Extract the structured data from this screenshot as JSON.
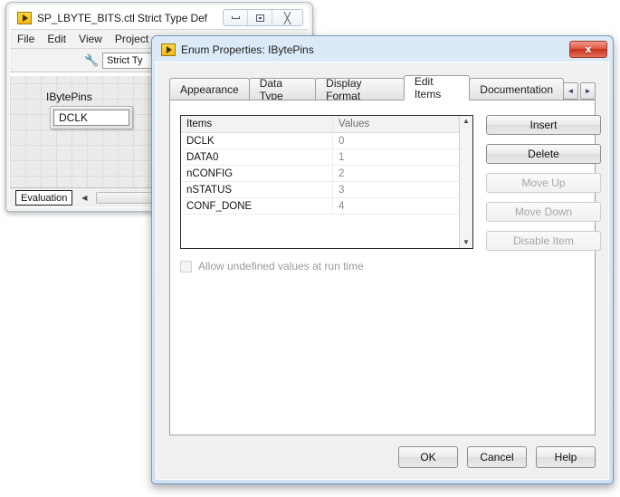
{
  "background_window": {
    "title": "SP_LBYTE_BITS.ctl Strict Type Def",
    "icon": "labview-run-arrow-icon",
    "window_buttons": {
      "minimize": "minimize-icon",
      "restore": "restore-icon",
      "close": "close-icon"
    },
    "menu": [
      {
        "label": "File"
      },
      {
        "label": "Edit"
      },
      {
        "label": "View"
      },
      {
        "label": "Project"
      }
    ],
    "toolbar": {
      "wrench_icon": "wrench-icon",
      "typedef_combo_value": "Strict Ty"
    },
    "canvas": {
      "control_label": "IBytePins",
      "control_value": "DCLK"
    },
    "status_bar": {
      "label": "Evaluation",
      "scroll_left_icon": "scroll-left-arrow-icon"
    }
  },
  "dialog": {
    "title": "Enum Properties: IBytePins",
    "icon": "labview-run-arrow-icon",
    "close_label": "x",
    "tabs": [
      {
        "label": "Appearance",
        "selected": false
      },
      {
        "label": "Data Type",
        "selected": false
      },
      {
        "label": "Display Format",
        "selected": false
      },
      {
        "label": "Edit Items",
        "selected": true
      },
      {
        "label": "Documentation",
        "selected": false
      }
    ],
    "tab_nav": {
      "prev": "◄",
      "next": "►"
    },
    "edit_items": {
      "columns": [
        "Items",
        "Values"
      ],
      "rows": [
        {
          "item": "DCLK",
          "value": "0"
        },
        {
          "item": "DATA0",
          "value": "1"
        },
        {
          "item": "nCONFIG",
          "value": "2"
        },
        {
          "item": "nSTATUS",
          "value": "3"
        },
        {
          "item": "CONF_DONE",
          "value": "4"
        }
      ],
      "scrollbar": {
        "up": "▲",
        "down": "▼"
      },
      "side_buttons": [
        {
          "label": "Insert",
          "disabled": false
        },
        {
          "label": "Delete",
          "disabled": false
        },
        {
          "label": "Move Up",
          "disabled": true
        },
        {
          "label": "Move Down",
          "disabled": true
        },
        {
          "label": "Disable Item",
          "disabled": true
        }
      ],
      "checkbox": {
        "label": "Allow undefined values at run time",
        "checked": false,
        "disabled": true
      }
    },
    "footer_buttons": [
      {
        "label": "OK"
      },
      {
        "label": "Cancel"
      },
      {
        "label": "Help"
      }
    ]
  },
  "colors": {
    "dialog_border": "#6f9cc4",
    "close_button_red": "#c9301a",
    "lv_icon_yellow": "#f7b718",
    "disabled_text": "#a6a6a6"
  }
}
